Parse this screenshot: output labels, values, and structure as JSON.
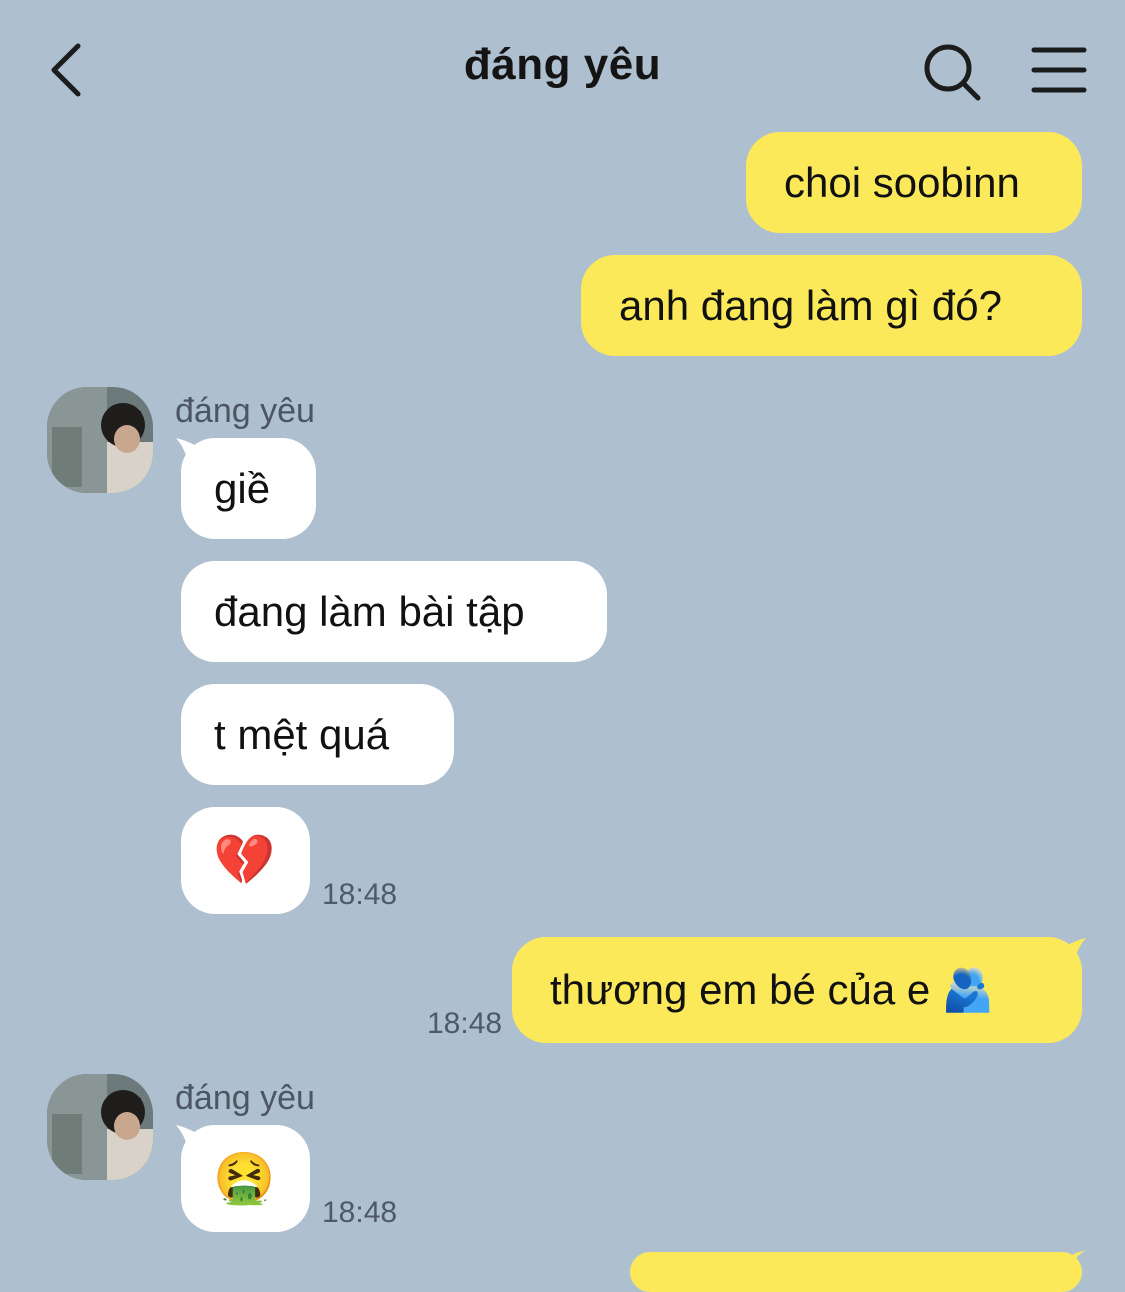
{
  "header": {
    "title": "đáng yêu",
    "back_icon": "chevron-left-icon",
    "search_icon": "search-icon",
    "menu_icon": "hamburger-menu-icon"
  },
  "colors": {
    "background": "#aebfd0",
    "my_bubble": "#fbe95a",
    "their_bubble": "#ffffff"
  },
  "messages": [
    {
      "from": "me",
      "text": "choi soobinn"
    },
    {
      "from": "me",
      "text": "anh đang làm gì đó?"
    },
    {
      "from": "them",
      "sender": "đáng yêu",
      "text": "giề"
    },
    {
      "from": "them",
      "text": "đang làm bài tập"
    },
    {
      "from": "them",
      "text": "t mệt quá"
    },
    {
      "from": "them",
      "text": "💔",
      "time": "18:48"
    },
    {
      "from": "me",
      "text": "thương em bé của e 🫂",
      "time": "18:48"
    },
    {
      "from": "them",
      "sender": "đáng yêu",
      "text": "🤮",
      "time": "18:48"
    }
  ]
}
